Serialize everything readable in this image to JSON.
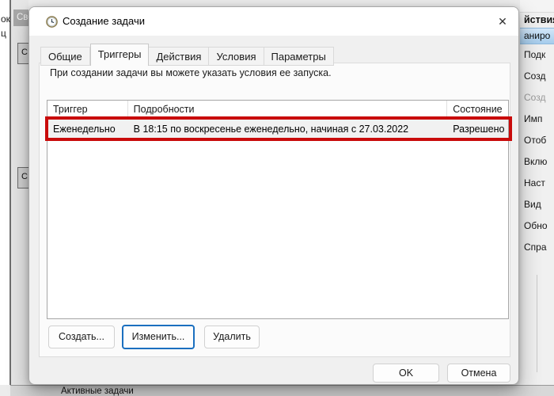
{
  "background": {
    "left_edge": {
      "fragment_top": "ок",
      "fragment_bottom": "ц"
    },
    "properties_pane": {
      "header": "Сво",
      "button_top": "С",
      "button_bottom": "С"
    },
    "active_tasks_bar": "Активные задачи"
  },
  "actions_panel": {
    "header": "йствия",
    "selected": "аниро",
    "items": [
      "Подк",
      "Созд",
      "Созд",
      "Имп",
      "Отоб",
      "Вклю",
      "Наст",
      "Вид",
      "Обно",
      "Спра"
    ]
  },
  "dialog": {
    "title": "Создание задачи",
    "close_glyph": "✕",
    "tabs": [
      "Общие",
      "Триггеры",
      "Действия",
      "Условия",
      "Параметры"
    ],
    "active_tab": "Триггеры",
    "description": "При создании задачи вы можете указать условия ее запуска.",
    "table": {
      "columns": [
        "Триггер",
        "Подробности",
        "Состояние"
      ],
      "rows": [
        {
          "trigger": "Еженедельно",
          "details": "В 18:15 по воскресенье еженедельно, начиная с 27.03.2022",
          "state": "Разрешено"
        }
      ]
    },
    "buttons": {
      "create": "Создать...",
      "edit": "Изменить...",
      "delete": "Удалить",
      "ok": "OK",
      "cancel": "Отмена"
    },
    "annotation_color": "#c90b0b"
  }
}
